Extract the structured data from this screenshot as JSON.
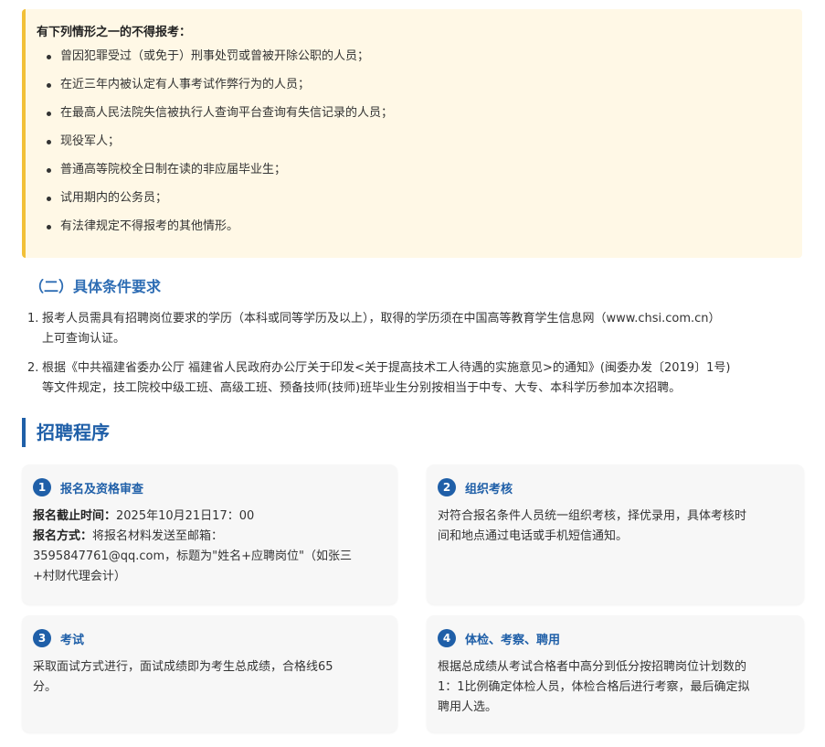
{
  "notice": {
    "title": "有下列情形之一的不得报考：",
    "items": [
      "曾因犯罪受过（或免于）刑事处罚或曾被开除公职的人员；",
      "在近三年内被认定有人事考试作弊行为的人员；",
      "在最高人民法院失信被执行人查询平台查询有失信记录的人员；",
      "现役军人；",
      "普通高等院校全日制在读的非应届毕业生；",
      "试用期内的公务员；",
      "有法律规定不得报考的其他情形。"
    ]
  },
  "specific": {
    "heading": "（二）具体条件要求",
    "items": [
      {
        "num": "1.",
        "line1": "报考人员需具有招聘岗位要求的学历（本科或同等学历及以上），取得的学历须在中国高等教育学生信息网（www.chsi.com.cn）",
        "line2": "上可查询认证。"
      },
      {
        "num": "2.",
        "line1": "根据《中共福建省委办公厅 福建省人民政府办公厅关于印发<关于提高技术工人待遇的实施意见>的通知》(闽委办发〔2019〕1号)",
        "line2": "等文件规定，技工院校中级工班、高级工班、预备技师(技师)班毕业生分别按相当于中专、大专、本科学历参加本次招聘。"
      }
    ]
  },
  "procedure": {
    "title": "招聘程序",
    "cards": [
      {
        "number": "1",
        "title": "报名及资格审查",
        "deadline_label": "报名截止时间：",
        "deadline_value": "2025年10月21日17：00",
        "method_label": "报名方式：",
        "method_value": "将报名材料发送至邮箱：",
        "method_line2": "3595847761@qq.com，标题为\"姓名+应聘岗位\"（如张三",
        "method_line3": "+村财代理会计）"
      },
      {
        "number": "2",
        "title": "组织考核",
        "line1": "对符合报名条件人员统一组织考核，择优录用，具体考核时",
        "line2": "间和地点通过电话或手机短信通知。"
      },
      {
        "number": "3",
        "title": "考试",
        "line1": "采取面试方式进行，面试成绩即为考生总成绩，合格线65",
        "line2": "分。"
      },
      {
        "number": "4",
        "title": "体检、考察、聘用",
        "line1": "根据总成绩从考试合格者中高分到低分按招聘岗位计划数的",
        "line2": "1：1比例确定体检人员，体检合格后进行考察，最后确定拟",
        "line3": "聘用人选。"
      }
    ]
  }
}
